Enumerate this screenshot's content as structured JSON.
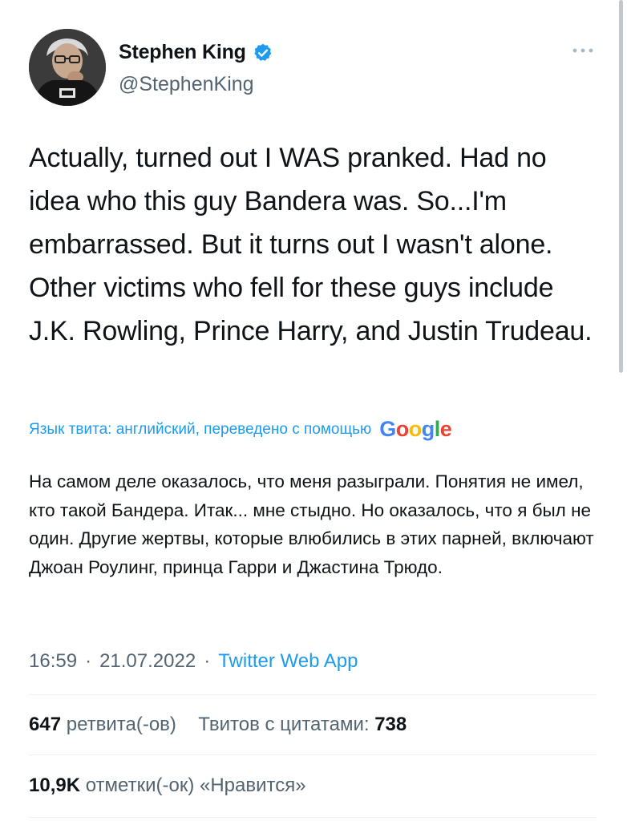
{
  "author": {
    "display_name": "Stephen King",
    "handle": "@StephenKing",
    "verified": true,
    "avatar_icon": "avatar-photo"
  },
  "tweet": {
    "text": "Actually, turned out I WAS pranked. Had no idea who this guy Bandera was. So...I'm embarrassed. But it turns out I wasn't alone. Other victims who fell for these guys include J.K. Rowling, Prince Harry, and Justin Trudeau.",
    "translation_label": "Язык твита: английский, переведено с помощью",
    "translation_provider": "Google",
    "translated_text": "На самом деле оказалось, что меня разыграли. Понятия не имел, кто такой Бандера. Итак... мне стыдно. Но оказалось, что я был не один. Другие жертвы, которые влюбились в этих парней, включают Джоан Роулинг, принца Гарри и Джастина Трюдо."
  },
  "meta": {
    "time": "16:59",
    "date": "21.07.2022",
    "separator": "·",
    "source": "Twitter Web App"
  },
  "stats": {
    "retweets_count": "647",
    "retweets_label": "ретвита(-ов)",
    "quotes_label": "Твитов с цитатами:",
    "quotes_count": "738",
    "likes_count": "10,9K",
    "likes_label": "отметки(-ок) «Нравится»"
  },
  "colors": {
    "accent": "#1d9bf0",
    "text": "#0f1419",
    "secondary": "#536471",
    "divider": "#eff3f4"
  }
}
